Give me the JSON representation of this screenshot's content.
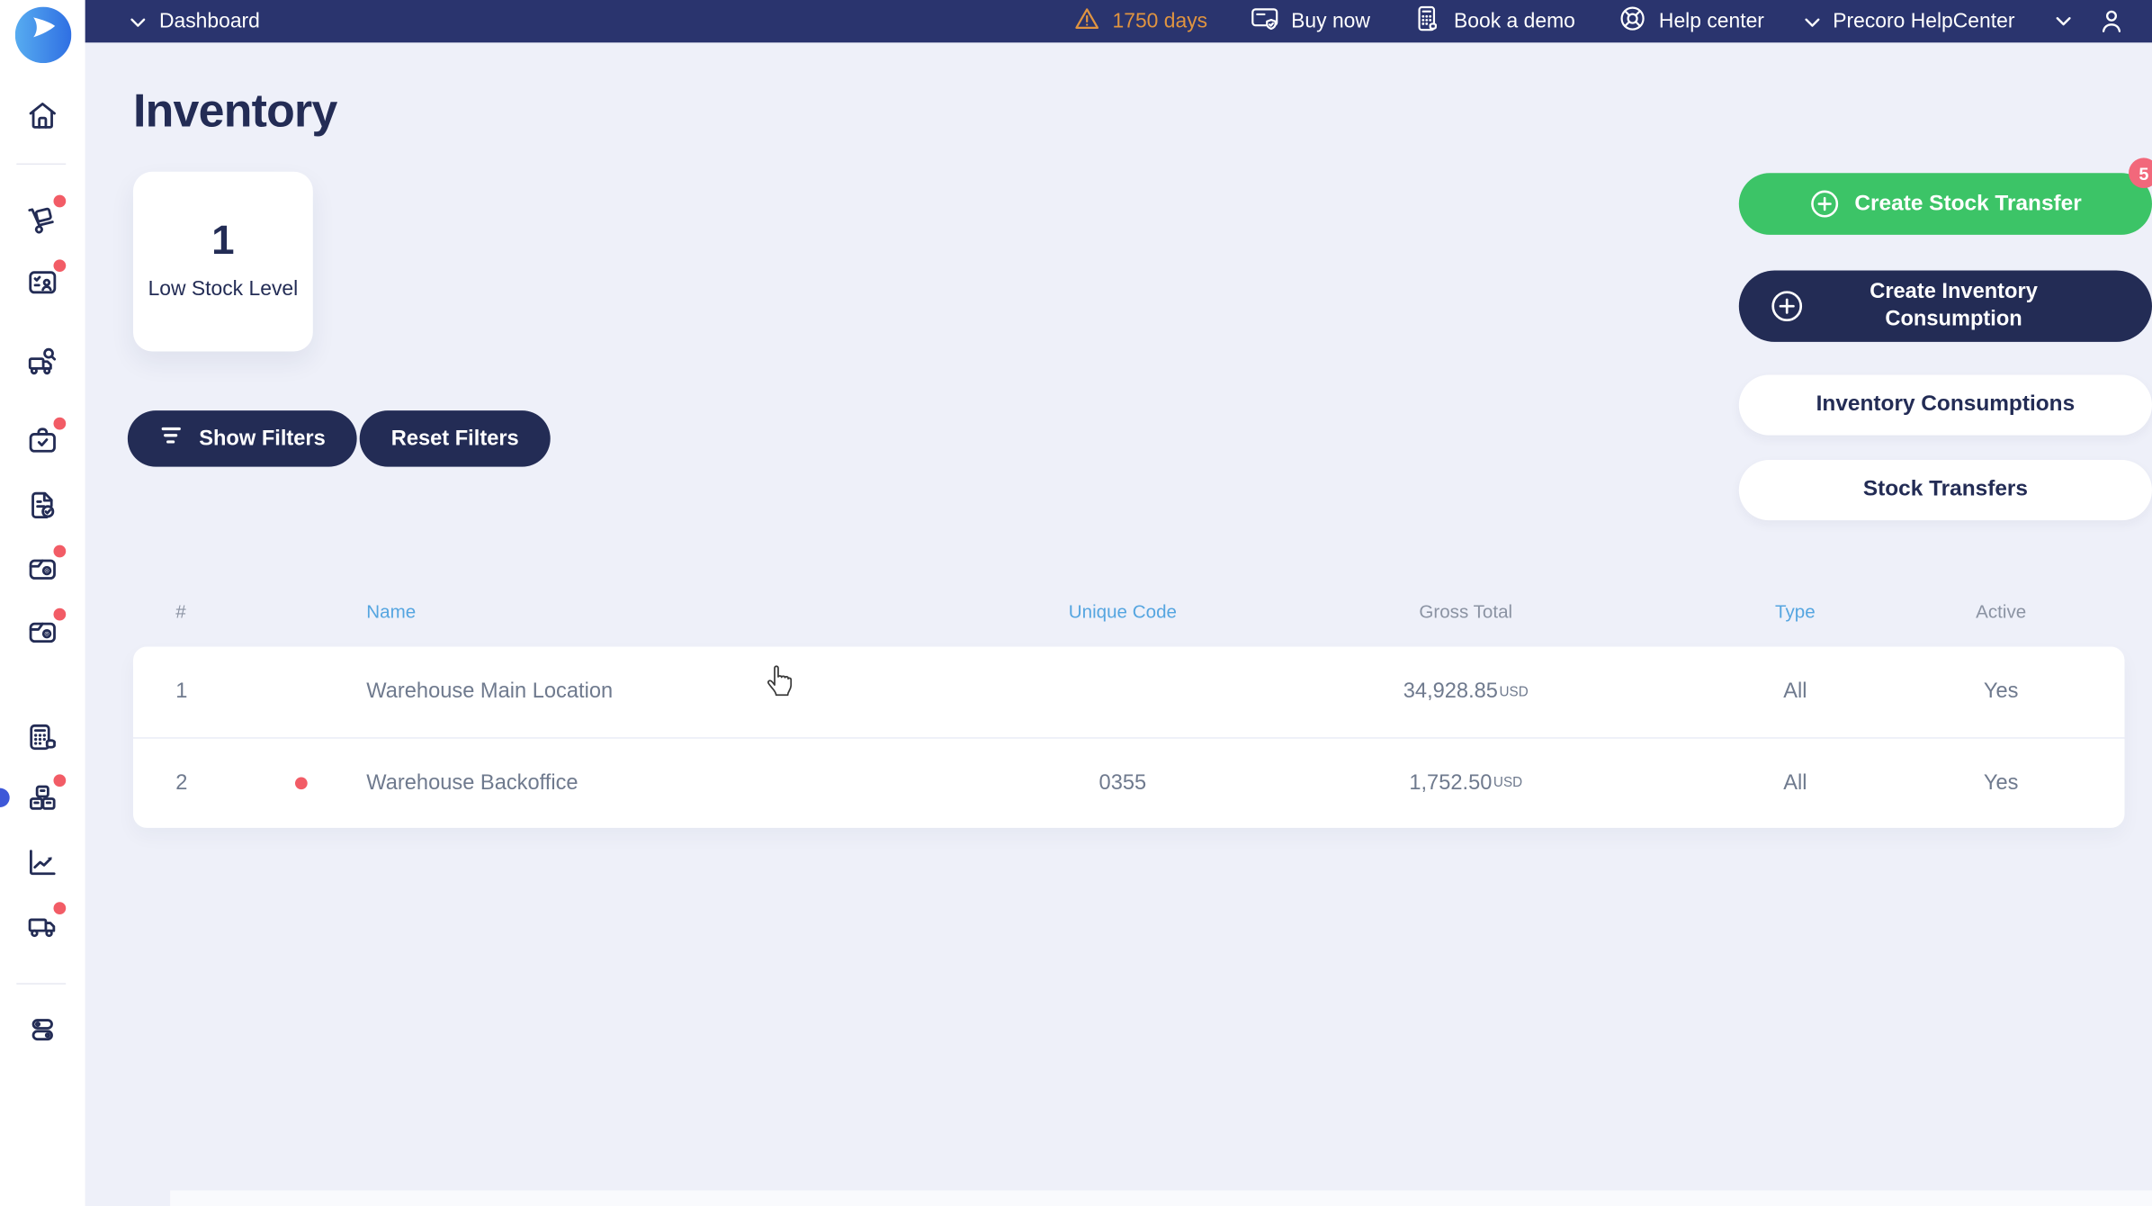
{
  "colors": {
    "topbar_navy": "#2A346E",
    "navy": "#232C55",
    "green": "#3CC467",
    "badge_pink": "#F2687B",
    "alert_red": "#F25C66",
    "active_item_blue": "#3E58D8",
    "warning_orange": "#E09440",
    "sort_link_blue": "#55A5E0",
    "muted_header_gray": "#8B93A3",
    "cell_gray": "#6F7A8E",
    "page_bg": "#EEF0F9"
  },
  "topbar": {
    "dashboard": "Dashboard",
    "trial_countdown": "1750 days",
    "buy_now": "Buy now",
    "book_demo": "Book a demo",
    "help_center": "Help center",
    "help_dropdown": "Precoro HelpCenter"
  },
  "sidebar": {
    "icons": [
      "home-icon",
      "shopping-cart-icon",
      "request-clipboard-user-icon",
      "supplier-truck-search-icon",
      "purchase-bag-check-icon",
      "document-check-icon",
      "receipt-capture-icon",
      "credit-note-capture-icon",
      "budget-calculator-icon",
      "inventory-boxes-icon",
      "reports-chart-icon",
      "delivery-truck-icon",
      "settings-toggles-icon"
    ],
    "active_item": "inventory-boxes-icon"
  },
  "page": {
    "title": "Inventory",
    "stat_card": {
      "value": "1",
      "label": "Low Stock Level"
    },
    "show_filters": "Show Filters",
    "reset_filters": "Reset Filters",
    "actions": {
      "create_stock_transfer": "Create Stock Transfer",
      "create_stock_transfer_badge": "5",
      "create_inventory_consumption": "Create Inventory Consumption",
      "inventory_consumptions": "Inventory Consumptions",
      "stock_transfers": "Stock Transfers"
    }
  },
  "table": {
    "columns": [
      {
        "label": "#",
        "sortable": false
      },
      {
        "label": "Name",
        "sortable": true
      },
      {
        "label": "Unique Code",
        "sortable": true
      },
      {
        "label": "Gross Total",
        "sortable": false
      },
      {
        "label": "Type",
        "sortable": true
      },
      {
        "label": "Active",
        "sortable": false
      }
    ],
    "rows": [
      {
        "num": "1",
        "low_stock": false,
        "name": "Warehouse Main Location",
        "unique_code": "",
        "gross_total": "34,928.85",
        "currency": "USD",
        "type": "All",
        "active": "Yes"
      },
      {
        "num": "2",
        "low_stock": true,
        "name": "Warehouse Backoffice",
        "unique_code": "0355",
        "gross_total": "1,752.50",
        "currency": "USD",
        "type": "All",
        "active": "Yes"
      }
    ]
  }
}
